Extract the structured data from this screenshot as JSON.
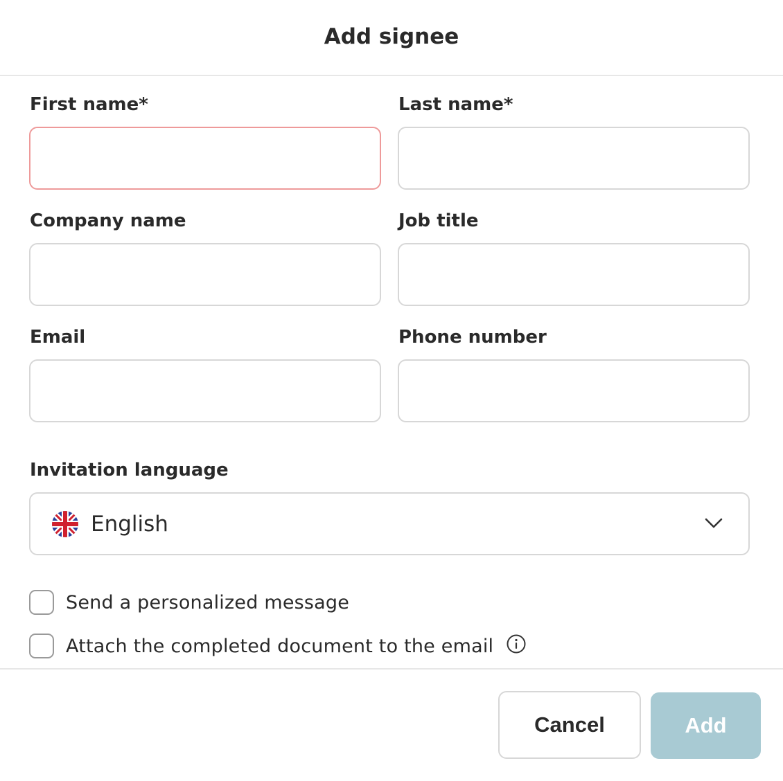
{
  "dialog": {
    "title": "Add signee"
  },
  "fields": {
    "first_name": {
      "label": "First name*",
      "value": "",
      "placeholder": ""
    },
    "last_name": {
      "label": "Last name*",
      "value": "",
      "placeholder": ""
    },
    "company_name": {
      "label": "Company name",
      "value": "",
      "placeholder": ""
    },
    "job_title": {
      "label": "Job title",
      "value": "",
      "placeholder": ""
    },
    "email": {
      "label": "Email",
      "value": "",
      "placeholder": ""
    },
    "phone_number": {
      "label": "Phone number",
      "value": "",
      "placeholder": ""
    }
  },
  "invitation_language": {
    "label": "Invitation language",
    "selected": "English",
    "flag_icon": "uk-flag-icon"
  },
  "options": {
    "personalized_message": {
      "label": "Send a personalized message",
      "checked": false
    },
    "attach_document": {
      "label": "Attach the completed document to the email",
      "checked": false,
      "info_icon": "info-icon"
    }
  },
  "footer": {
    "cancel_label": "Cancel",
    "add_label": "Add"
  },
  "colors": {
    "error_border": "#ee9a9a",
    "field_border": "#d7d7d7",
    "primary_disabled": "#a8cad3",
    "text": "#2a2a2a"
  }
}
